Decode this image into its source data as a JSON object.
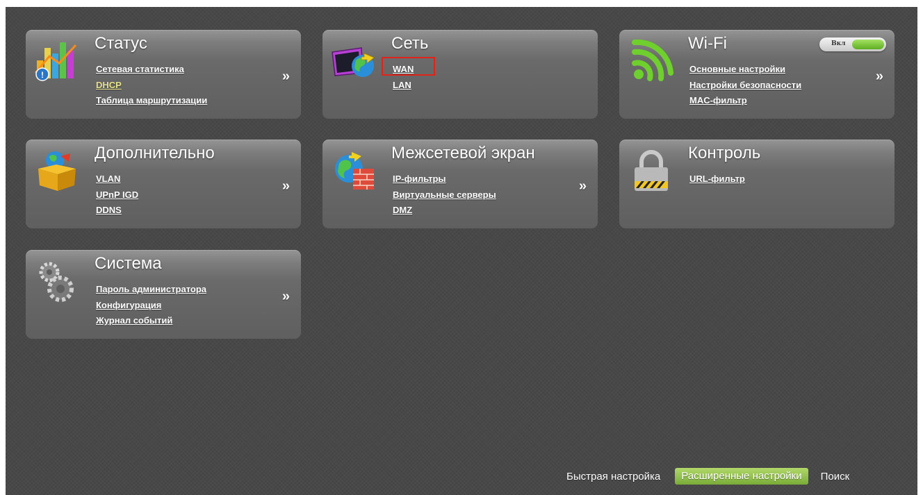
{
  "panels": {
    "status": {
      "title": "Статус",
      "links": [
        "Сетевая статистика",
        "DHCP",
        "Таблица маршрутизации"
      ],
      "more": "»",
      "icon": "chart-bars-icon"
    },
    "network": {
      "title": "Сеть",
      "links": [
        "WAN",
        "LAN"
      ],
      "icon": "globe-monitor-icon",
      "highlight_color": "#e0231b"
    },
    "wifi": {
      "title": "Wi-Fi",
      "toggle_label": "Вкл",
      "toggle_on": true,
      "links": [
        "Основные настройки",
        "Настройки безопасности",
        "MAC-фильтр"
      ],
      "more": "»",
      "icon": "wifi-icon"
    },
    "advanced": {
      "title": "Дополнительно",
      "links": [
        "VLAN",
        "UPnP IGD",
        "DDNS"
      ],
      "more": "»",
      "icon": "package-box-icon"
    },
    "firewall": {
      "title": "Межсетевой экран",
      "links": [
        "IP-фильтры",
        "Виртуальные серверы",
        "DMZ"
      ],
      "more": "»",
      "icon": "firewall-globe-icon"
    },
    "control": {
      "title": "Контроль",
      "links": [
        "URL-фильтр"
      ],
      "icon": "padlock-icon"
    },
    "system": {
      "title": "Система",
      "links": [
        "Пароль администратора",
        "Конфигурация",
        "Журнал событий"
      ],
      "more": "»",
      "icon": "gears-icon"
    }
  },
  "bottom_nav": {
    "quick_setup": "Быстрая настройка",
    "advanced_settings": "Расширенные настройки",
    "search": "Поиск"
  },
  "colors": {
    "background": "#484848",
    "highlight_link": "#e7e28a",
    "active_nav": "#8fbf45"
  }
}
